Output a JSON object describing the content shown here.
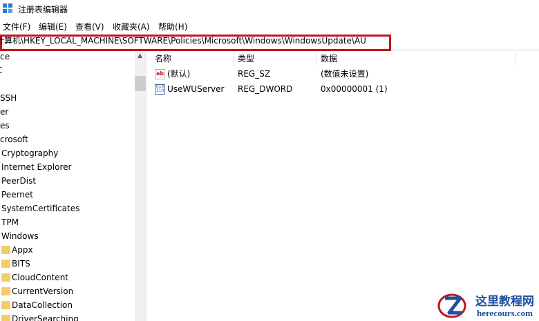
{
  "window": {
    "title": "注册表编辑器"
  },
  "menu": [
    "文件(F)",
    "编辑(E)",
    "查看(V)",
    "收藏夹(A)",
    "帮助(H)"
  ],
  "address": {
    "path": "计算机\\HKEY_LOCAL_MACHINE\\SOFTWARE\\Policies\\Microsoft\\Windows\\WindowsUpdate\\AU"
  },
  "tree": {
    "items": [
      "ce",
      "C",
      "",
      "SSH",
      "er",
      "es",
      "crosoft",
      "Cryptography",
      "Internet Explorer",
      "PeerDist",
      "Peernet",
      "SystemCertificates",
      "TPM",
      "Windows",
      "Appx",
      "BITS",
      "CloudContent",
      "CurrentVersion",
      "DataCollection",
      "DriverSearching"
    ]
  },
  "list": {
    "headers": [
      "名称",
      "类型",
      "数据"
    ],
    "rows": [
      {
        "name": "(默认)",
        "type": "REG_SZ",
        "data": "(数值未设置)",
        "icon": "string-value-icon"
      },
      {
        "name": "UseWUServer",
        "type": "REG_DWORD",
        "data": "0x00000001 (1)",
        "icon": "binary-value-icon"
      }
    ]
  },
  "watermark": {
    "name": "这里教程网",
    "url": "herecours.com"
  }
}
